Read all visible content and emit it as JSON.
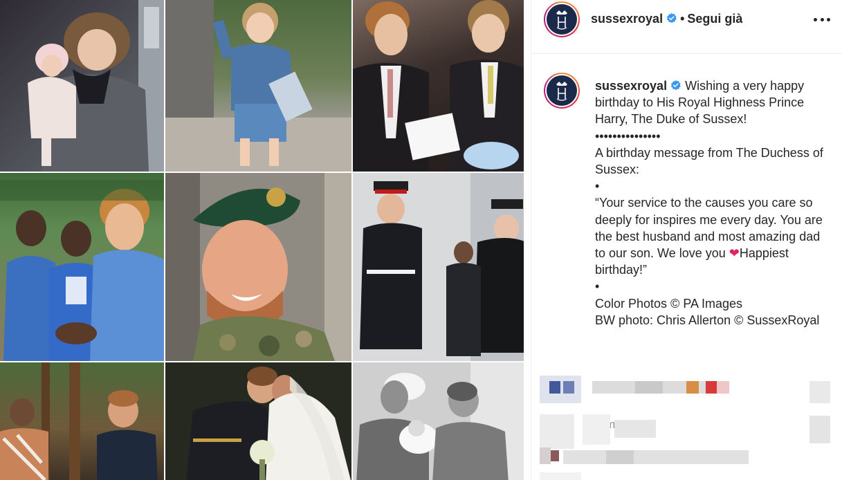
{
  "post": {
    "username": "sussexroyal",
    "follow_status": "Segui già",
    "more_icon": "more-horizontal-icon",
    "verified_icon": "verified-badge-icon"
  },
  "caption": {
    "username": "sussexroyal",
    "lines": [
      "Wishing a very happy birthday to His Royal Highness Prince Harry, The Duke of Sussex!",
      "•••••••••••••••",
      "A birthday message from The Duchess of Sussex:",
      "•",
      "“Your service to the causes you care so deeply for inspires me every day. You are the best husband and most amazing dad to our son. We love you",
      "Happiest birthday!”",
      "•",
      "Color Photos © PA Images",
      "BW photo: Chris Allerton © SussexRoyal"
    ],
    "heart_emoji": "❤"
  },
  "timestamp": "8 m",
  "colors": {
    "accent_blue": "#3897f0",
    "heart_red": "#e0245e",
    "avatar_navy": "#1b2a4a"
  }
}
